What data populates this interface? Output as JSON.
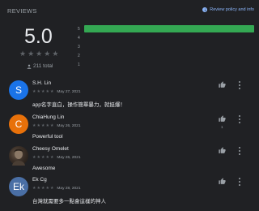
{
  "header": {
    "title": "REVIEWS",
    "policy_link": "Review policy and info",
    "info_icon": "info-icon"
  },
  "summary": {
    "rating": "5.0",
    "stars": 0,
    "total": "211 total",
    "person_icon": "person-icon"
  },
  "histogram": [
    {
      "label": "5",
      "fraction": 1.0
    },
    {
      "label": "4",
      "fraction": 0.0
    },
    {
      "label": "3",
      "fraction": 0.0
    },
    {
      "label": "2",
      "fraction": 0.0
    },
    {
      "label": "1",
      "fraction": 0.0
    }
  ],
  "colors": {
    "background": "#202124",
    "bar": "#34a853",
    "link": "#8ab4f8",
    "star_empty": "#5f6368"
  },
  "reviews": [
    {
      "name": "S.H. Lin",
      "avatar_letter": "S",
      "avatar_color": "#1a73e8",
      "date": "May 27, 2021",
      "text": "app名字直白，操作簡單暴力，就挺爆！",
      "helpful_count": ""
    },
    {
      "name": "ChiaHung Lin",
      "avatar_letter": "C",
      "avatar_color": "#e8710a",
      "date": "May 26, 2021",
      "text": "Powerful tool",
      "helpful_count": "1"
    },
    {
      "name": "Cheesy Omelet",
      "avatar_letter": "",
      "avatar_color": "#3a2f27",
      "date": "May 26, 2021",
      "text": "Awesome",
      "helpful_count": ""
    },
    {
      "name": "Ek Cg",
      "avatar_letter": "Ek",
      "avatar_color": "#4a6fa5",
      "date": "May 28, 2021",
      "text": "台灣就需要多一點會這樣的神人",
      "helpful_count": ""
    }
  ]
}
